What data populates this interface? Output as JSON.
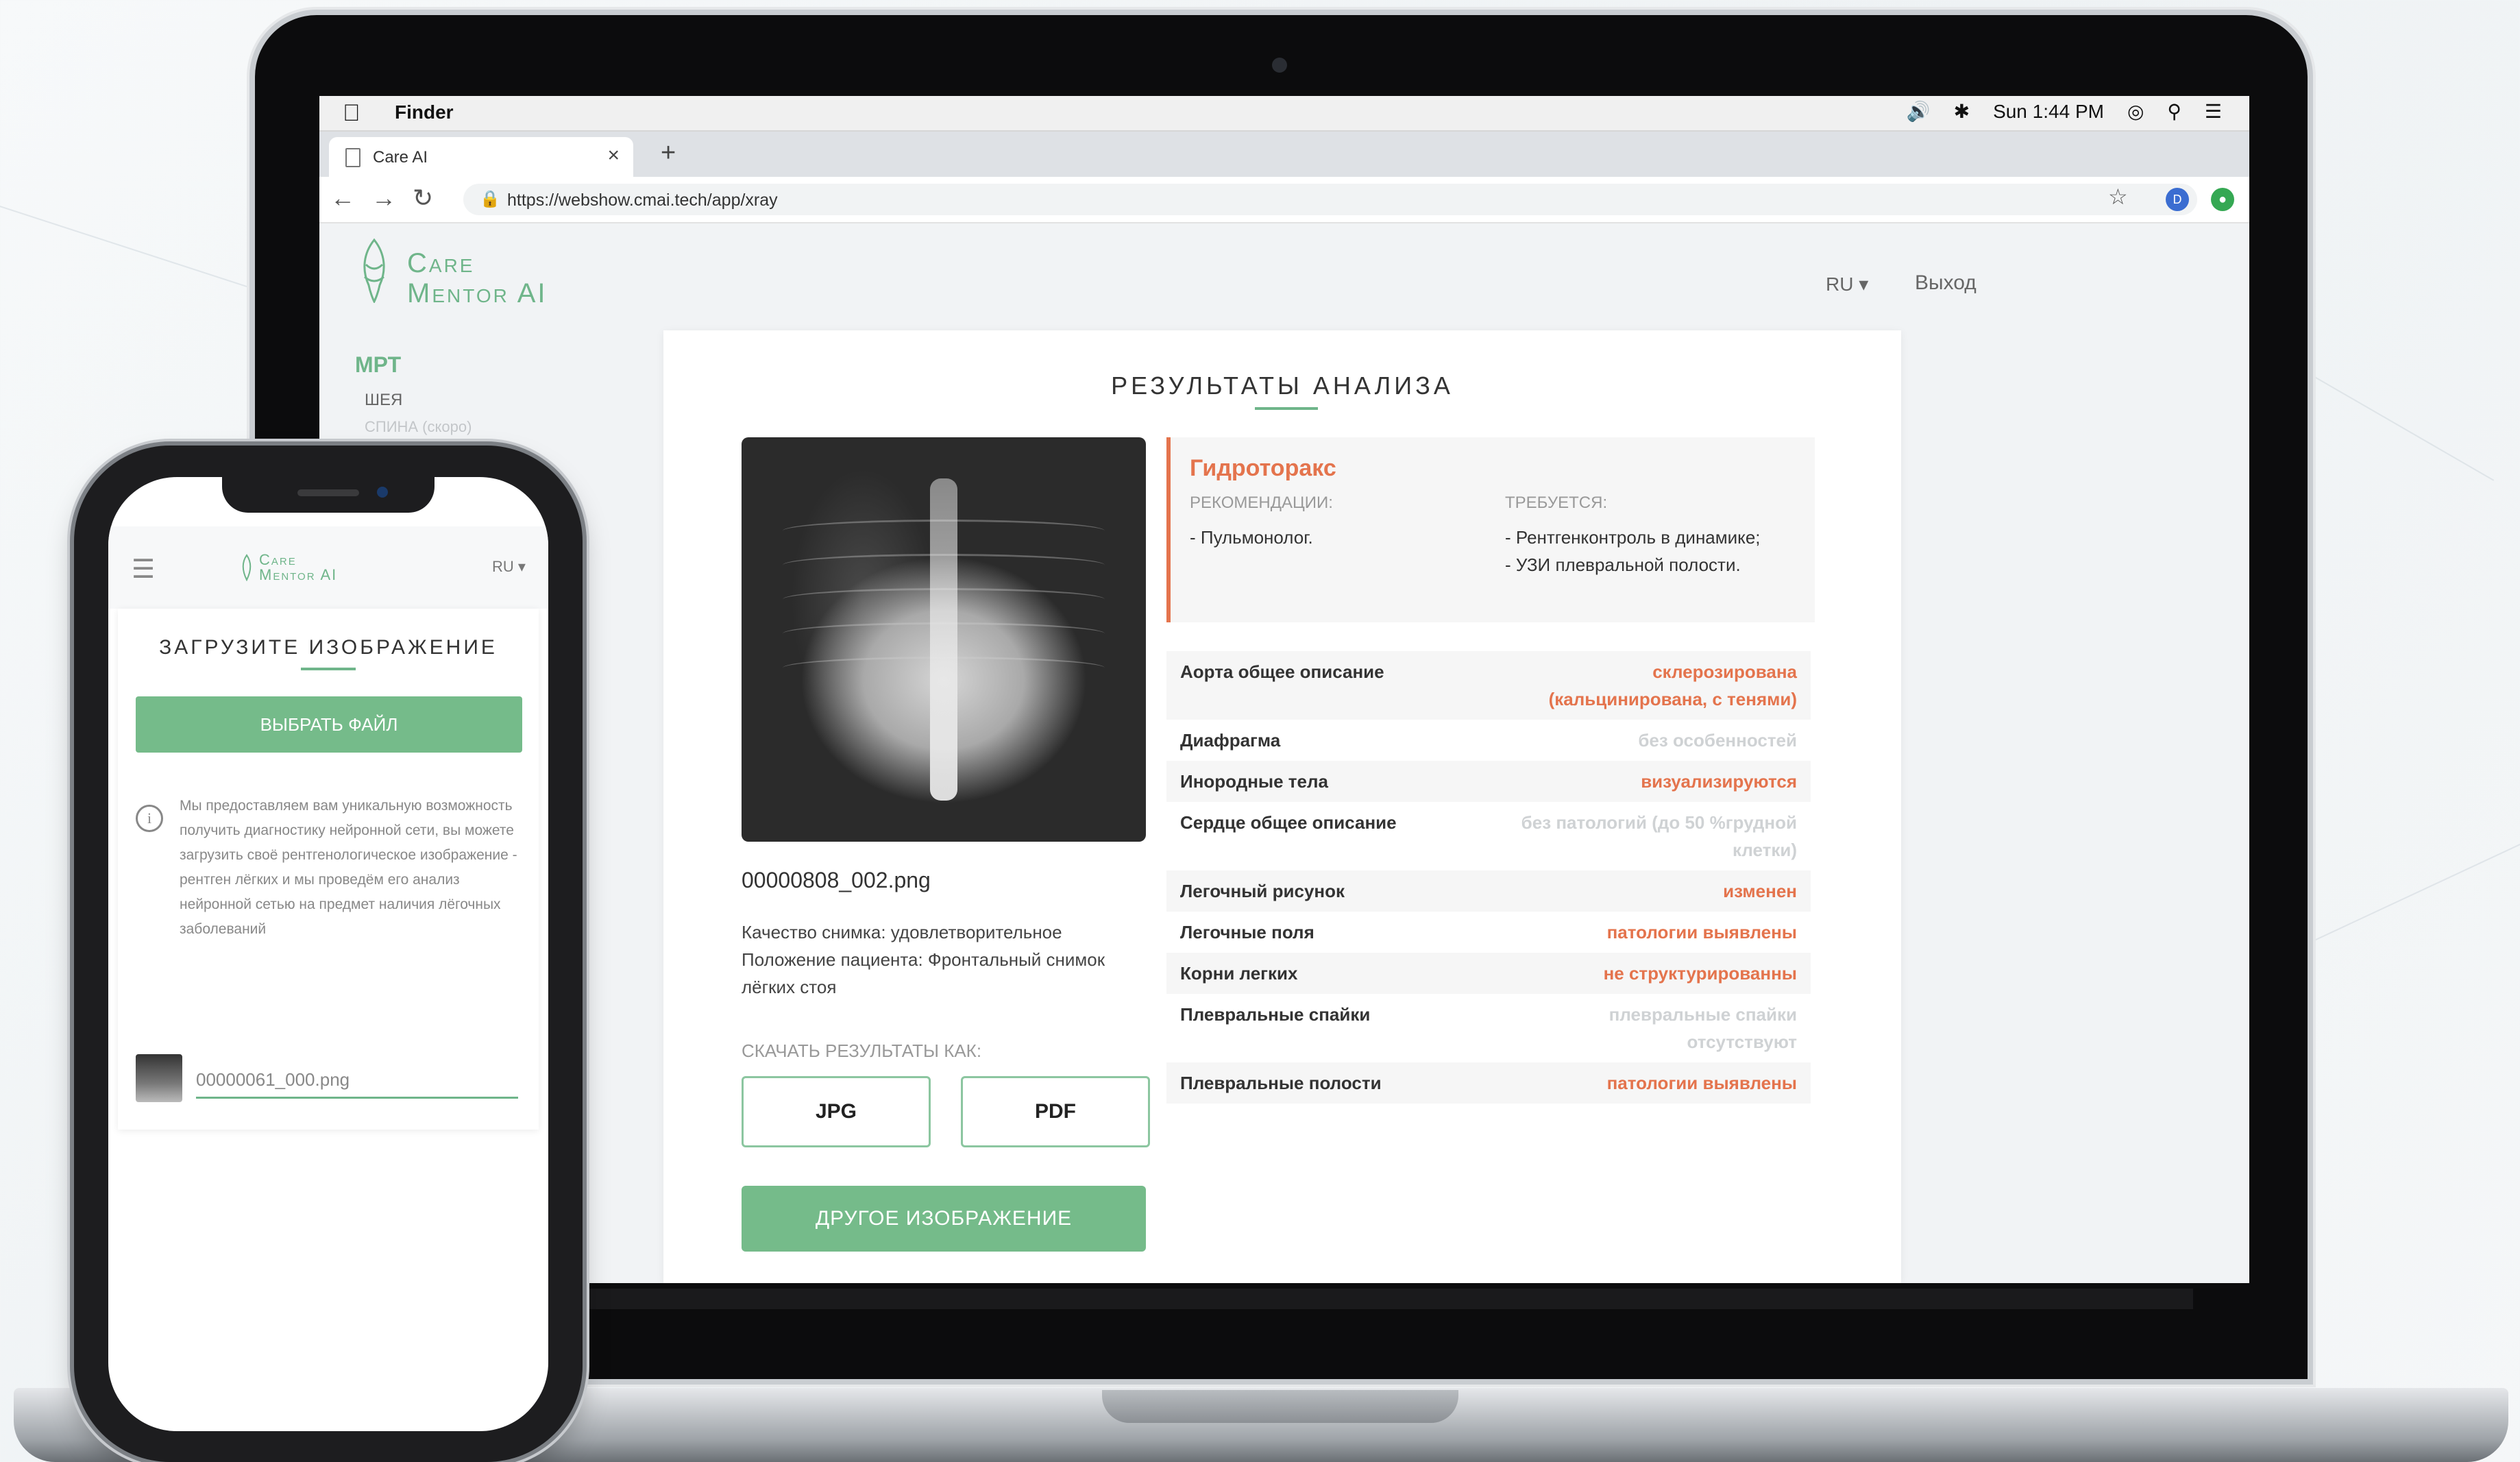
{
  "menubar": {
    "app_name": "Finder",
    "clock": "Sun 1:44 PM"
  },
  "browser": {
    "tab_title": "Care AI",
    "url": "https://webshow.cmai.tech/app/xray",
    "profile_initial": "D"
  },
  "app": {
    "logo_line1": "Care",
    "logo_line2": "Mentor AI",
    "lang": "RU",
    "logout": "Выход",
    "sidebar": {
      "section": "МРТ",
      "items": [
        "ШЕЯ",
        "СПИНА (скоро)"
      ]
    },
    "results": {
      "title": "РЕЗУЛЬТАТЫ АНАЛИЗА",
      "filename": "00000808_002.png",
      "quality": "Качество снимка: удовлетворительное",
      "position": "Положение пациента: Фронтальный снимок лёгких стоя",
      "download_label": "СКАЧАТЬ РЕЗУЛЬТАТЫ КАК:",
      "btn_jpg": "JPG",
      "btn_pdf": "PDF",
      "btn_other": "ДРУГОЕ ИЗОБРАЖЕНИЕ"
    },
    "diagnosis": {
      "title": "Гидроторакс",
      "recommendations_label": "РЕКОМЕНДАЦИИ:",
      "recommendations": "- Пульмонолог.",
      "required_label": "ТРЕБУЕТСЯ:",
      "required_1": "- Рентгенконтроль в динамике;",
      "required_2": "- УЗИ плевральной полости."
    },
    "findings": [
      {
        "name": "Аорта общее описание",
        "value": "склерозирована (кальцинирована, с тенями)",
        "status": "bad"
      },
      {
        "name": "Диафрагма",
        "value": "без особенностей",
        "status": "ok"
      },
      {
        "name": "Инородные тела",
        "value": "визуализируются",
        "status": "bad"
      },
      {
        "name": "Сердце общее описание",
        "value": "без патологий (до 50 %грудной клетки)",
        "status": "ok"
      },
      {
        "name": "Легочный рисунок",
        "value": "изменен",
        "status": "bad"
      },
      {
        "name": "Легочные поля",
        "value": "патологии выявлены",
        "status": "bad"
      },
      {
        "name": "Корни легких",
        "value": "не структурированны",
        "status": "bad"
      },
      {
        "name": "Плевральные спайки",
        "value": "плевральные спайки отсутствуют",
        "status": "ok"
      },
      {
        "name": "Плевральные полости",
        "value": "патологии выявлены",
        "status": "bad"
      }
    ]
  },
  "phone": {
    "logo_line1": "Care",
    "logo_line2": "Mentor AI",
    "lang": "RU",
    "title": "ЗАГРУЗИТЕ ИЗОБРАЖЕНИЕ",
    "choose_file": "ВЫБРАТЬ ФАЙЛ",
    "info": "Мы предоставляем вам уникальную возможность получить диагностику нейронной сети, вы можете загрузить своё рентгенологическое изображение - рентген лёгких и мы проведём его анализ нейронной сетью на предмет наличия лёгочных заболеваний",
    "file_name": "00000061_000.png"
  },
  "colors": {
    "accent_green": "#6fb58a",
    "alert_orange": "#e4744d"
  }
}
